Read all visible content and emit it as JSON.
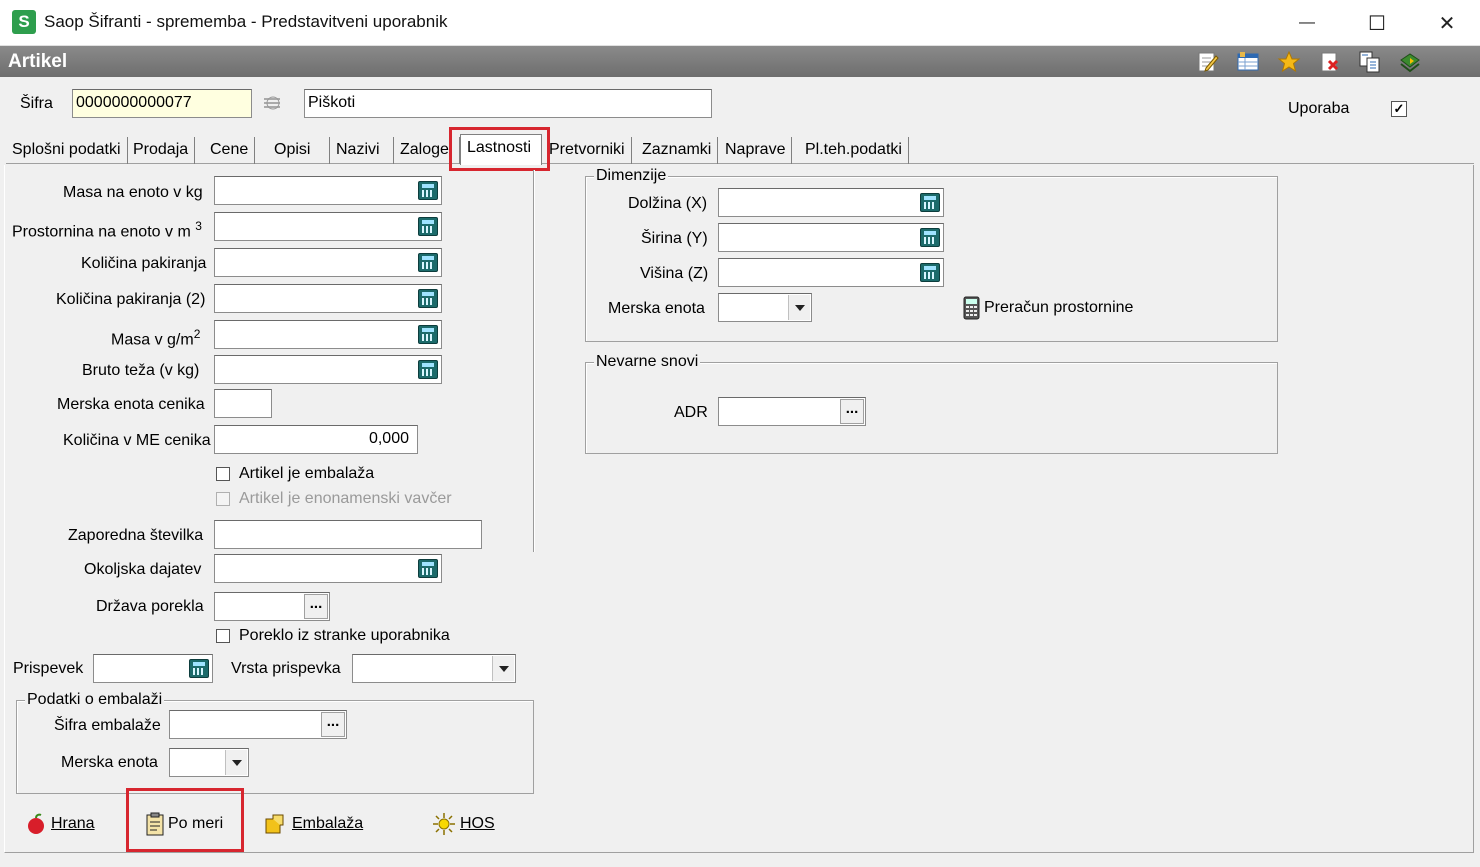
{
  "window": {
    "app_icon_letter": "S",
    "title": "Saop Šifranti - sprememba - Predstavitveni uporabnik",
    "minimize": "—",
    "maximize": "☐",
    "close": "✕"
  },
  "header": {
    "title": "Artikel",
    "toolbar_icons": [
      "edit-icon",
      "table-icon",
      "star-icon",
      "delete-icon",
      "copy-icon",
      "exit-icon"
    ]
  },
  "top": {
    "sifra_label": "Šifra",
    "sifra_value": "0000000000077",
    "name_value": "Piškoti",
    "uporaba_label": "Uporaba",
    "uporaba_checked": "✓"
  },
  "tabs": [
    "Splošni podatki",
    "Prodaja",
    "Cene",
    "Opisi",
    "Nazivi",
    "Zaloge",
    "Lastnosti",
    "Pretvorniki",
    "Zaznamki",
    "Naprave",
    "Pl.teh.podatki"
  ],
  "left": {
    "masa_label": "Masa na enoto v kg",
    "prostornina_label": "Prostornina na enoto v m",
    "prostornina_sup": "3",
    "kolicina_pak_label": "Količina pakiranja",
    "kolicina_pak2_label": "Količina pakiranja (2)",
    "masa_gm2_label": "Masa v g/m",
    "masa_gm2_sup": "2",
    "bruto_label": "Bruto teža (v kg)",
    "me_cenika_label": "Merska enota cenika",
    "kol_me_cenika_label": "Količina v ME cenika",
    "kol_me_cenika_value": "0,000",
    "embalaza_chk_label": "Artikel je embalaža",
    "vavcer_chk_label": "Artikel je enonamenski vavčer",
    "zaporedna_label": "Zaporedna številka",
    "okoljska_label": "Okoljska dajatev",
    "drzava_label": "Država porekla",
    "poreklo_chk_label": "Poreklo iz stranke uporabnika",
    "prispevek_label": "Prispevek",
    "vrsta_prispevka_label": "Vrsta prispevka",
    "embalaza_group_title": "Podatki o embalaži",
    "sifra_embalaze_label": "Šifra embalaže",
    "merska_enota_label": "Merska enota",
    "dots": "..."
  },
  "right": {
    "dimenzije_title": "Dimenzije",
    "dolzina_label": "Dolžina (X)",
    "sirina_label": "Širina (Y)",
    "visina_label": "Višina (Z)",
    "merska_enota_label": "Merska enota",
    "preracun_label": "Preračun prostornine",
    "nevarne_title": "Nevarne snovi",
    "adr_label": "ADR",
    "dots": "..."
  },
  "bottom": {
    "hrana": "Hrana",
    "po_meri": "Po meri",
    "embalaza": "Embalaža",
    "hos": "HOS"
  },
  "colors": {
    "highlight": "#d7262f",
    "header_bg": "#7a7a7a",
    "app_icon": "#2e9e4d"
  }
}
